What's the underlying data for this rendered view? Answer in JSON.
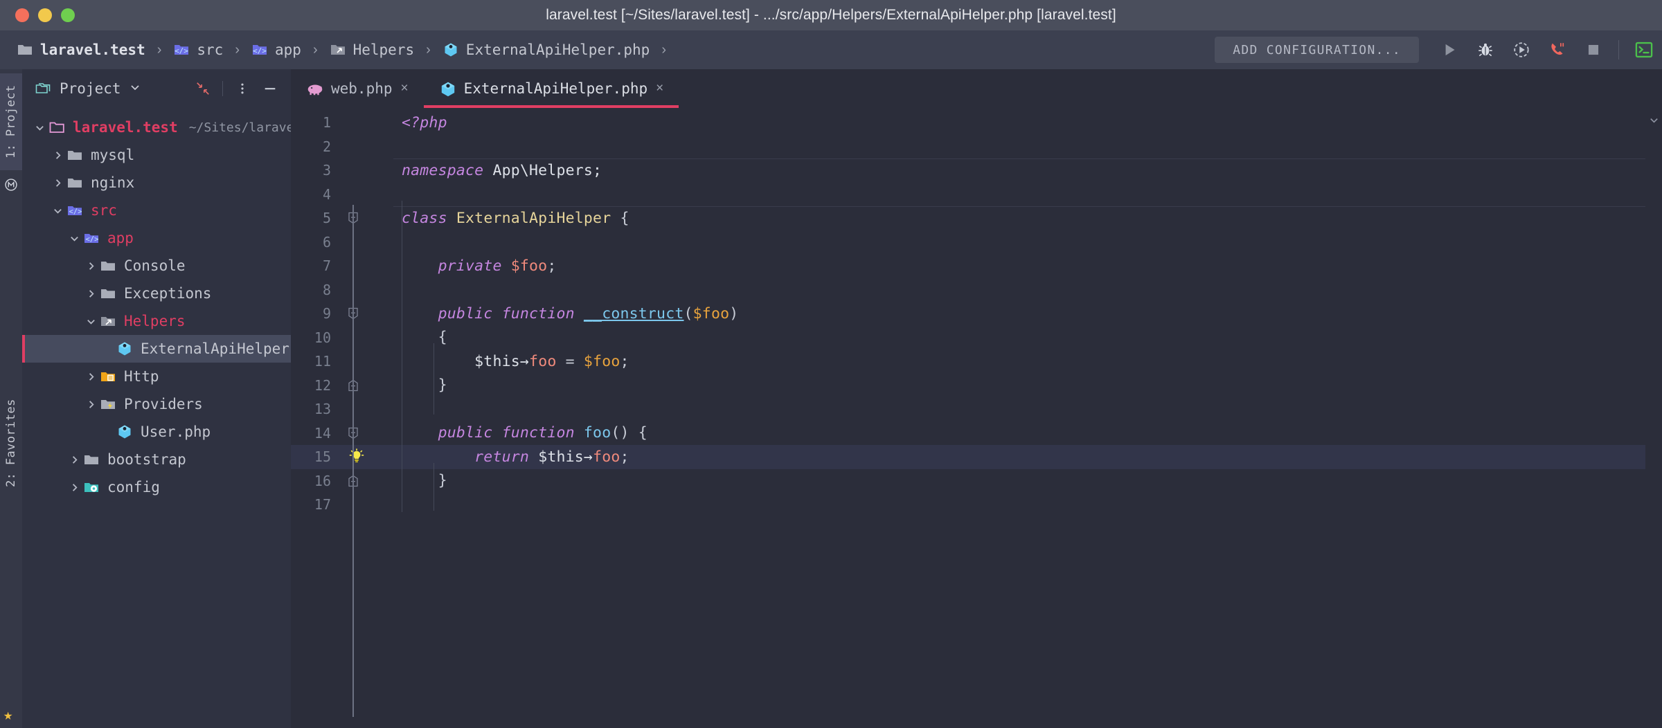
{
  "window": {
    "title": "laravel.test [~/Sites/laravel.test] - .../src/app/Helpers/ExternalApiHelper.php [laravel.test]",
    "traffic_lights": [
      "close",
      "minimize",
      "maximize"
    ],
    "colors": {
      "close": "#f4705c",
      "minimize": "#f2c94c",
      "maximize": "#6fcf4f",
      "accent": "#e03e63",
      "titlebar_bg": "#4a4e5c",
      "navbar_bg": "#3c4050",
      "panel_bg": "#2f3241",
      "editor_bg": "#2b2d3a"
    }
  },
  "navbar": {
    "breadcrumbs": [
      {
        "label": "laravel.test",
        "icon": "folder-icon",
        "bold": true
      },
      {
        "label": "src",
        "icon": "source-folder-icon",
        "bold": false
      },
      {
        "label": "app",
        "icon": "source-folder-icon",
        "bold": false
      },
      {
        "label": "Helpers",
        "icon": "generated-folder-icon",
        "bold": false
      },
      {
        "label": "ExternalApiHelper.php",
        "icon": "php-class-icon",
        "bold": false
      }
    ],
    "separator": "›",
    "add_configuration_label": "ADD CONFIGURATION...",
    "actions": [
      {
        "name": "run-button",
        "icon": "play-icon"
      },
      {
        "name": "debug-button",
        "icon": "bug-icon"
      },
      {
        "name": "run-with-coverage-button",
        "icon": "coverage-icon"
      },
      {
        "name": "profile-button",
        "icon": "phone-call-icon"
      },
      {
        "name": "stop-button",
        "icon": "stop-square-icon"
      },
      {
        "name": "terminal-button",
        "icon": "terminal-icon"
      }
    ]
  },
  "rail": {
    "top_tab": "1: Project",
    "structure_icon": "structure-icon",
    "bottom_tab": "2: Favorites",
    "star_icon": "star-icon"
  },
  "panel": {
    "title": "Project",
    "dropdown_icon": "chevron-down-icon",
    "actions": [
      {
        "name": "collapse-all-button",
        "icon": "collapse-all-icon"
      },
      {
        "name": "panel-options-button",
        "icon": "more-vertical-icon"
      },
      {
        "name": "hide-panel-button",
        "icon": "minus-icon"
      }
    ],
    "tree": [
      {
        "label": "laravel.test",
        "path": "~/Sites/laravel.test",
        "depth": 0,
        "state": "open",
        "icon": "project-folder-icon",
        "style": "crimson-bold",
        "selected": false
      },
      {
        "label": "mysql",
        "path": "",
        "depth": 1,
        "state": "closed",
        "icon": "folder-icon",
        "style": "normal",
        "selected": false
      },
      {
        "label": "nginx",
        "path": "",
        "depth": 1,
        "state": "closed",
        "icon": "folder-icon",
        "style": "normal",
        "selected": false
      },
      {
        "label": "src",
        "path": "",
        "depth": 1,
        "state": "open",
        "icon": "source-folder-icon",
        "style": "crimson",
        "selected": false
      },
      {
        "label": "app",
        "path": "",
        "depth": 2,
        "state": "open",
        "icon": "source-folder-icon",
        "style": "crimson",
        "selected": false
      },
      {
        "label": "Console",
        "path": "",
        "depth": 3,
        "state": "closed",
        "icon": "folder-icon",
        "style": "normal",
        "selected": false
      },
      {
        "label": "Exceptions",
        "path": "",
        "depth": 3,
        "state": "closed",
        "icon": "folder-icon",
        "style": "normal",
        "selected": false
      },
      {
        "label": "Helpers",
        "path": "",
        "depth": 3,
        "state": "open",
        "icon": "generated-folder-icon",
        "style": "crimson",
        "selected": false
      },
      {
        "label": "ExternalApiHelper.php",
        "path": "",
        "depth": 4,
        "state": "leaf",
        "icon": "php-class-icon",
        "style": "normal",
        "selected": true
      },
      {
        "label": "Http",
        "path": "",
        "depth": 3,
        "state": "closed",
        "icon": "http-folder-icon",
        "style": "normal",
        "selected": false
      },
      {
        "label": "Providers",
        "path": "",
        "depth": 3,
        "state": "closed",
        "icon": "providers-folder-icon",
        "style": "normal",
        "selected": false
      },
      {
        "label": "User.php",
        "path": "",
        "depth": 4,
        "state": "leaf",
        "icon": "php-class-icon",
        "style": "normal",
        "selected": false
      },
      {
        "label": "bootstrap",
        "path": "",
        "depth": 2,
        "state": "closed",
        "icon": "folder-icon",
        "style": "normal",
        "selected": false
      },
      {
        "label": "config",
        "path": "",
        "depth": 2,
        "state": "closed",
        "icon": "config-folder-icon",
        "style": "normal",
        "selected": false
      }
    ]
  },
  "editor": {
    "tabs": [
      {
        "label": "web.php",
        "icon": "php-file-icon",
        "active": false,
        "close_glyph": "×"
      },
      {
        "label": "ExternalApiHelper.php",
        "icon": "php-class-icon",
        "active": true,
        "close_glyph": "×"
      }
    ],
    "current_line": 15,
    "line_numbers": [
      "1",
      "2",
      "3",
      "4",
      "5",
      "6",
      "7",
      "8",
      "9",
      "10",
      "11",
      "12",
      "13",
      "14",
      "15",
      "16",
      "17"
    ],
    "lines": [
      {
        "n": "1",
        "indent": 0,
        "tokens": [
          {
            "t": "<?php",
            "c": "kw"
          }
        ]
      },
      {
        "n": "2",
        "indent": 0,
        "tokens": []
      },
      {
        "n": "3",
        "indent": 0,
        "sep": true,
        "tokens": [
          {
            "t": "namespace",
            "c": "kw"
          },
          {
            "t": " App\\Helpers;",
            "c": "plain"
          }
        ]
      },
      {
        "n": "4",
        "indent": 0,
        "tokens": []
      },
      {
        "n": "5",
        "indent": 0,
        "sep": true,
        "fold": "open",
        "tokens": [
          {
            "t": "class",
            "c": "kw"
          },
          {
            "t": " ",
            "c": "plain"
          },
          {
            "t": "ExternalApiHelper",
            "c": "cls"
          },
          {
            "t": " {",
            "c": "punc"
          }
        ]
      },
      {
        "n": "6",
        "indent": 0,
        "tokens": []
      },
      {
        "n": "7",
        "indent": 1,
        "tokens": [
          {
            "t": "    ",
            "c": "plain"
          },
          {
            "t": "private",
            "c": "kw"
          },
          {
            "t": " ",
            "c": "plain"
          },
          {
            "t": "$foo",
            "c": "field"
          },
          {
            "t": ";",
            "c": "punc"
          }
        ]
      },
      {
        "n": "8",
        "indent": 1,
        "tokens": []
      },
      {
        "n": "9",
        "indent": 1,
        "fold": "open",
        "tokens": [
          {
            "t": "    ",
            "c": "plain"
          },
          {
            "t": "public function",
            "c": "kw"
          },
          {
            "t": " ",
            "c": "plain"
          },
          {
            "t": "__construct",
            "c": "method-u"
          },
          {
            "t": "(",
            "c": "punc"
          },
          {
            "t": "$foo",
            "c": "param"
          },
          {
            "t": ")",
            "c": "punc"
          }
        ]
      },
      {
        "n": "10",
        "indent": 1,
        "tokens": [
          {
            "t": "    {",
            "c": "punc"
          }
        ]
      },
      {
        "n": "11",
        "indent": 2,
        "tokens": [
          {
            "t": "        ",
            "c": "plain"
          },
          {
            "t": "$this",
            "c": "plain"
          },
          {
            "t": "→",
            "c": "plain"
          },
          {
            "t": "foo",
            "c": "field"
          },
          {
            "t": " = ",
            "c": "punc"
          },
          {
            "t": "$foo",
            "c": "param"
          },
          {
            "t": ";",
            "c": "punc"
          }
        ]
      },
      {
        "n": "12",
        "indent": 1,
        "fold": "close",
        "tokens": [
          {
            "t": "    }",
            "c": "punc"
          }
        ]
      },
      {
        "n": "13",
        "indent": 1,
        "tokens": []
      },
      {
        "n": "14",
        "indent": 1,
        "fold": "open",
        "tokens": [
          {
            "t": "    ",
            "c": "plain"
          },
          {
            "t": "public function",
            "c": "kw"
          },
          {
            "t": " ",
            "c": "plain"
          },
          {
            "t": "foo",
            "c": "method"
          },
          {
            "t": "() {",
            "c": "punc"
          }
        ]
      },
      {
        "n": "15",
        "indent": 2,
        "current": true,
        "bulb": true,
        "tokens": [
          {
            "t": "        ",
            "c": "plain"
          },
          {
            "t": "return",
            "c": "kw"
          },
          {
            "t": " ",
            "c": "plain"
          },
          {
            "t": "$this",
            "c": "plain"
          },
          {
            "t": "→",
            "c": "plain"
          },
          {
            "t": "foo",
            "c": "field"
          },
          {
            "t": ";",
            "c": "punc"
          }
        ]
      },
      {
        "n": "16",
        "indent": 1,
        "fold": "close",
        "tokens": [
          {
            "t": "    }",
            "c": "punc"
          }
        ]
      },
      {
        "n": "17",
        "indent": 0,
        "tokens": []
      }
    ]
  }
}
